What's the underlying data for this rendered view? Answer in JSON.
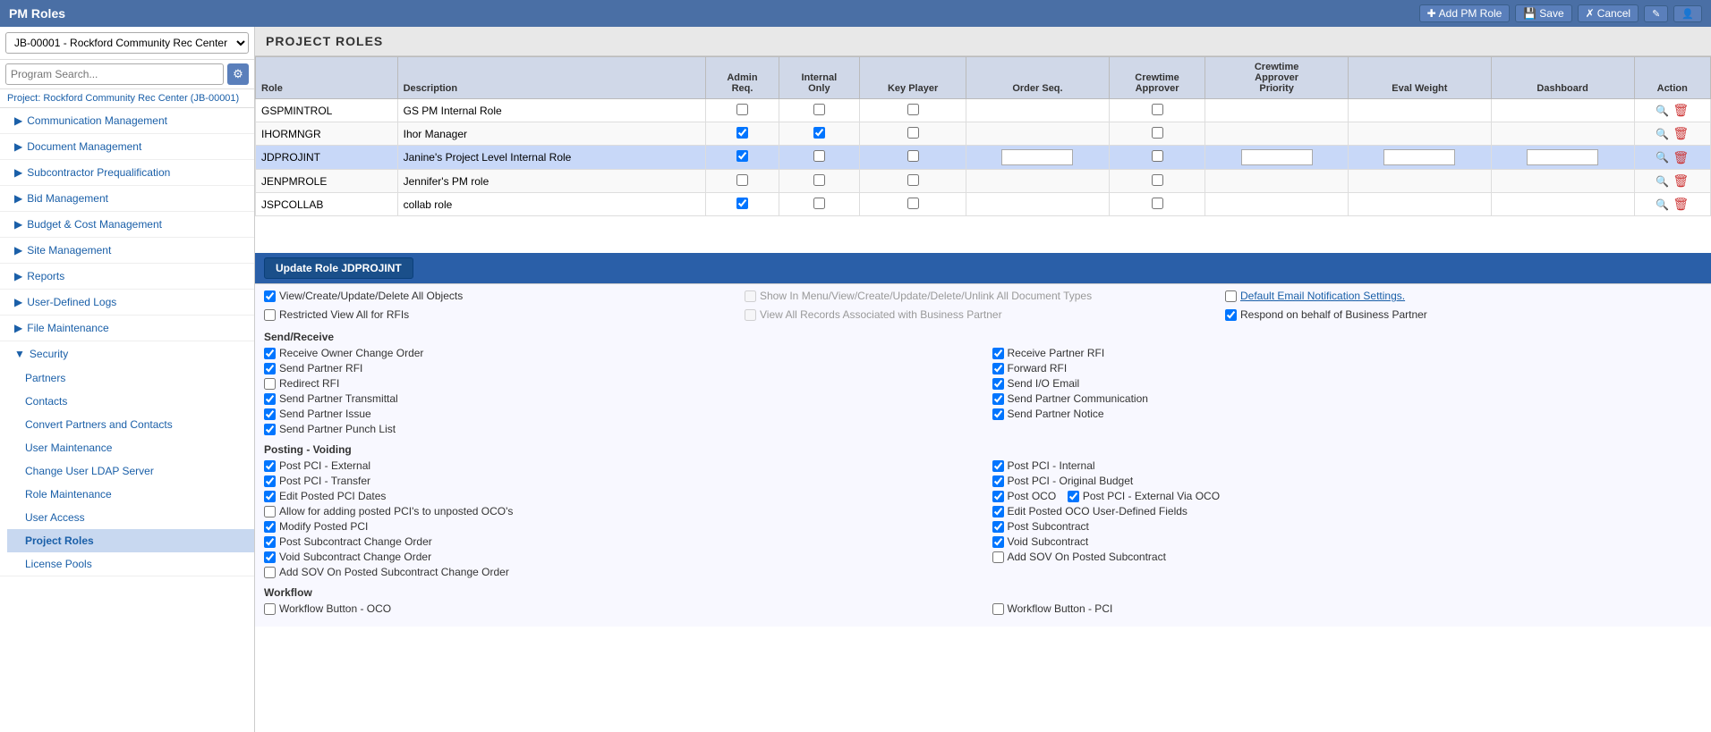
{
  "app": {
    "title": "PM Roles",
    "add_button": "Add PM Role",
    "save_button": "Save",
    "cancel_button": "Cancel"
  },
  "sidebar": {
    "project_selector": "JB-00001 - Rockford Community Rec Center",
    "search_placeholder": "Program Search...",
    "project_link": "Project: Rockford Community Rec Center (JB-00001)",
    "sections": [
      {
        "id": "communication",
        "label": "Communication Management",
        "expanded": false
      },
      {
        "id": "document",
        "label": "Document Management",
        "expanded": false
      },
      {
        "id": "subcontractor",
        "label": "Subcontractor Prequalification",
        "expanded": false
      },
      {
        "id": "bid",
        "label": "Bid Management",
        "expanded": false
      },
      {
        "id": "budget",
        "label": "Budget & Cost Management",
        "expanded": false
      },
      {
        "id": "site",
        "label": "Site Management",
        "expanded": false
      },
      {
        "id": "reports",
        "label": "Reports",
        "expanded": false
      },
      {
        "id": "user-defined",
        "label": "User-Defined Logs",
        "expanded": false
      },
      {
        "id": "file",
        "label": "File Maintenance",
        "expanded": false
      },
      {
        "id": "security",
        "label": "Security",
        "expanded": true
      }
    ],
    "security_items": [
      {
        "id": "partners",
        "label": "Partners",
        "active": false
      },
      {
        "id": "contacts",
        "label": "Contacts",
        "active": false
      },
      {
        "id": "convert",
        "label": "Convert Partners and Contacts",
        "active": false
      },
      {
        "id": "user-maintenance",
        "label": "User Maintenance",
        "active": false
      },
      {
        "id": "ldap",
        "label": "Change User LDAP Server",
        "active": false
      },
      {
        "id": "role-maintenance",
        "label": "Role Maintenance",
        "active": false
      },
      {
        "id": "user-access",
        "label": "User Access",
        "active": false
      },
      {
        "id": "project-roles",
        "label": "Project Roles",
        "active": true
      },
      {
        "id": "license-pools",
        "label": "License Pools",
        "active": false
      }
    ]
  },
  "main": {
    "section_title": "PROJECT ROLES",
    "table": {
      "columns": [
        "Role",
        "Description",
        "Admin Req.",
        "Internal Only",
        "Key Player",
        "Order Seq.",
        "Crewtime Approver",
        "Crewtime Approver Priority",
        "Eval Weight",
        "Dashboard",
        "Action"
      ],
      "rows": [
        {
          "id": "GSPMINTROL",
          "description": "GS PM Internal Role",
          "admin_req": false,
          "internal_only": false,
          "key_player": false,
          "order_seq": "",
          "crewtime_approver": false,
          "crewtime_approver_priority": "",
          "eval_weight": "",
          "dashboard": "",
          "selected": false
        },
        {
          "id": "IHORMNGR",
          "description": "Ihor Manager",
          "admin_req": true,
          "internal_only": true,
          "key_player": false,
          "order_seq": "",
          "crewtime_approver": false,
          "crewtime_approver_priority": "",
          "eval_weight": "",
          "dashboard": "",
          "selected": false
        },
        {
          "id": "JDPROJINT",
          "description": "Janine's Project Level Internal Role",
          "admin_req": true,
          "internal_only": false,
          "key_player": false,
          "order_seq": "",
          "crewtime_approver": false,
          "crewtime_approver_priority": "",
          "eval_weight": "",
          "dashboard": "",
          "selected": true
        },
        {
          "id": "JENPMROLE",
          "description": "Jennifer's PM role",
          "admin_req": false,
          "internal_only": false,
          "key_player": false,
          "order_seq": "",
          "crewtime_approver": false,
          "crewtime_approver_priority": "",
          "eval_weight": "",
          "dashboard": "",
          "selected": false
        },
        {
          "id": "JSPCOLLAB",
          "description": "collab role",
          "admin_req": true,
          "internal_only": false,
          "key_player": false,
          "order_seq": "",
          "crewtime_approver": false,
          "crewtime_approver_priority": "",
          "eval_weight": "",
          "dashboard": "",
          "selected": false
        }
      ]
    },
    "update_role_label": "Update Role JDPROJINT",
    "permissions": {
      "top_row": [
        {
          "id": "view-create-all",
          "label": "View/Create/Update/Delete All Objects",
          "checked": true,
          "disabled": false
        },
        {
          "id": "show-in-menu",
          "label": "Show In Menu/View/Create/Update/Delete/Unlink All Document Types",
          "checked": false,
          "disabled": true
        },
        {
          "id": "default-email",
          "label": "Default Email Notification Settings.",
          "checked": false,
          "disabled": false,
          "link": true
        }
      ],
      "row2": [
        {
          "id": "restricted-view-rfis",
          "label": "Restricted View All for RFIs",
          "checked": false,
          "disabled": false
        },
        {
          "id": "view-all-records",
          "label": "View All Records Associated with Business Partner",
          "checked": false,
          "disabled": true
        },
        {
          "id": "respond-behalf",
          "label": "Respond on behalf of Business Partner",
          "checked": true,
          "disabled": false
        }
      ],
      "sections": [
        {
          "title": "Send/Receive",
          "items_left": [
            {
              "id": "receive-owner-co",
              "label": "Receive Owner Change Order",
              "checked": true
            },
            {
              "id": "send-partner-rfi",
              "label": "Send Partner RFI",
              "checked": true
            },
            {
              "id": "redirect-rfi",
              "label": "Redirect RFI",
              "checked": false
            },
            {
              "id": "send-partner-transmittal",
              "label": "Send Partner Transmittal",
              "checked": true
            },
            {
              "id": "send-partner-issue",
              "label": "Send Partner Issue",
              "checked": true
            },
            {
              "id": "send-partner-punch",
              "label": "Send Partner Punch List",
              "checked": true
            }
          ],
          "items_right": [
            {
              "id": "receive-partner-rfi",
              "label": "Receive Partner RFI",
              "checked": true
            },
            {
              "id": "forward-rfi",
              "label": "Forward RFI",
              "checked": true
            },
            {
              "id": "send-io-email",
              "label": "Send I/O Email",
              "checked": true
            },
            {
              "id": "send-partner-comm",
              "label": "Send Partner Communication",
              "checked": true
            },
            {
              "id": "send-partner-notice",
              "label": "Send Partner Notice",
              "checked": true
            }
          ]
        },
        {
          "title": "Posting - Voiding",
          "items_left": [
            {
              "id": "post-pci-external",
              "label": "Post PCI - External",
              "checked": true
            },
            {
              "id": "post-pci-transfer",
              "label": "Post PCI - Transfer",
              "checked": true
            },
            {
              "id": "edit-posted-pci-dates",
              "label": "Edit Posted PCI Dates",
              "checked": true
            },
            {
              "id": "allow-posting-pci",
              "label": "Allow for adding posted PCI's to unposted OCO's",
              "checked": false
            },
            {
              "id": "modify-posted-pci",
              "label": "Modify Posted PCI",
              "checked": true
            },
            {
              "id": "post-subcontract-co",
              "label": "Post Subcontract Change Order",
              "checked": true
            },
            {
              "id": "void-subcontract-co",
              "label": "Void Subcontract Change Order",
              "checked": true
            },
            {
              "id": "add-sov-posted-subcontract-co",
              "label": "Add SOV On Posted Subcontract Change Order",
              "checked": false
            }
          ],
          "items_right": [
            {
              "id": "post-pci-internal",
              "label": "Post PCI - Internal",
              "checked": true
            },
            {
              "id": "post-pci-original-budget",
              "label": "Post PCI - Original Budget",
              "checked": true
            },
            {
              "id": "post-oco",
              "label": "Post OCO",
              "checked": true
            },
            {
              "id": "post-pci-external-via-oco",
              "label": "Post PCI - External Via OCO",
              "checked": true
            },
            {
              "id": "edit-posted-oco-fields",
              "label": "Edit Posted OCO User-Defined Fields",
              "checked": true
            },
            {
              "id": "post-subcontract",
              "label": "Post Subcontract",
              "checked": true
            },
            {
              "id": "void-subcontract",
              "label": "Void Subcontract",
              "checked": true
            },
            {
              "id": "add-sov-posted-subcontract",
              "label": "Add SOV On Posted Subcontract",
              "checked": false
            }
          ]
        },
        {
          "title": "Workflow",
          "items_left": [
            {
              "id": "workflow-button-oco",
              "label": "Workflow Button - OCO",
              "checked": false
            }
          ],
          "items_right": [
            {
              "id": "workflow-button-pci",
              "label": "Workflow Button - PCI",
              "checked": false
            }
          ]
        }
      ]
    }
  }
}
